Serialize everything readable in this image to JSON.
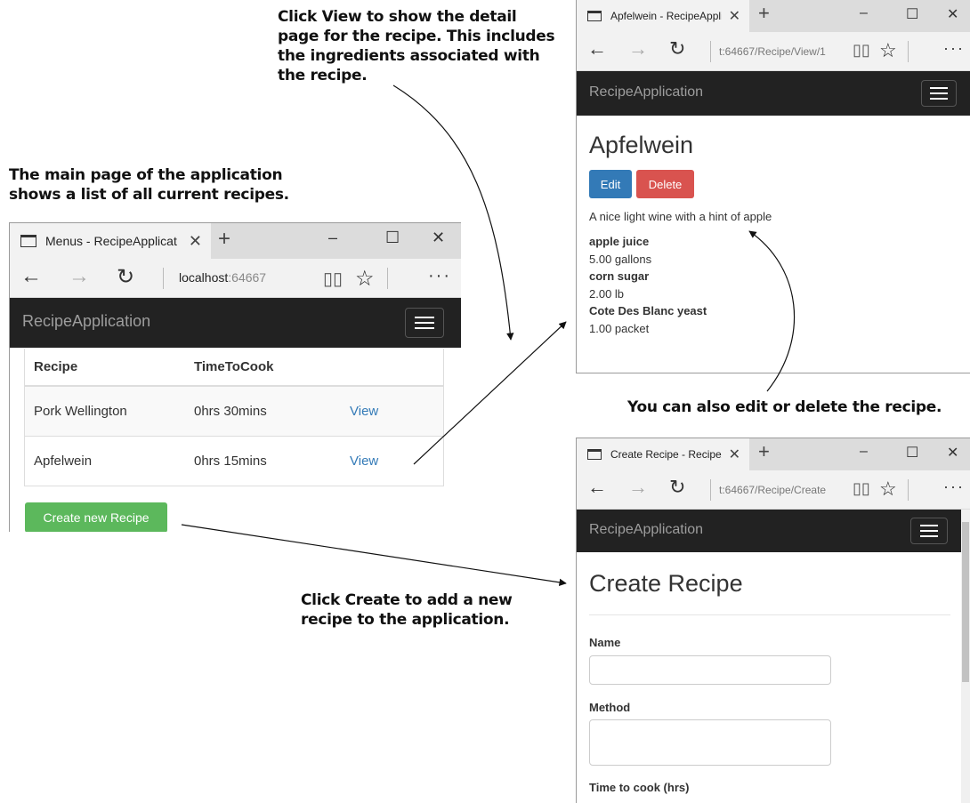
{
  "annotations": {
    "view": [
      "Click View to show the detail",
      "page for the recipe. This includes",
      "the ingredients associated with",
      "the recipe."
    ],
    "main": [
      "The main page of the application",
      "shows a list of all current recipes."
    ],
    "edit": "You can also edit or delete the recipe.",
    "create": [
      "Click Create to add a new",
      "recipe to the application."
    ]
  },
  "main_window": {
    "tab_title": "Menus - RecipeApplicat",
    "url_host": "localhost",
    "url_port": ":64667",
    "brand": "RecipeApplication",
    "table": {
      "headers": [
        "Recipe",
        "TimeToCook",
        ""
      ],
      "rows": [
        {
          "name": "Pork Wellington",
          "time": "0hrs 30mins",
          "action": "View"
        },
        {
          "name": "Apfelwein",
          "time": "0hrs 15mins",
          "action": "View"
        }
      ]
    },
    "create_button": "Create new Recipe"
  },
  "detail_window": {
    "tab_title": "Apfelwein - RecipeAppli",
    "url": "t:64667/Recipe/View/1",
    "brand": "RecipeApplication",
    "title": "Apfelwein",
    "edit_button": "Edit",
    "delete_button": "Delete",
    "description": "A nice light wine with a hint of apple",
    "ingredients": [
      {
        "name": "apple juice",
        "amount": "5.00 gallons"
      },
      {
        "name": "corn sugar",
        "amount": "2.00 lb"
      },
      {
        "name": "Cote Des Blanc yeast",
        "amount": "1.00 packet"
      }
    ]
  },
  "create_window": {
    "tab_title": "Create Recipe - RecipeA",
    "url": "t:64667/Recipe/Create",
    "brand": "RecipeApplication",
    "title": "Create Recipe",
    "fields": {
      "name_label": "Name",
      "method_label": "Method",
      "time_label": "Time to cook (hrs)"
    }
  },
  "icons": {
    "close": "✕",
    "new_tab": "+",
    "minimize": "–",
    "maximize": "☐",
    "back": "←",
    "forward": "→",
    "refresh": "↻",
    "reading_view": "📖",
    "favorite": "☆",
    "more": "···"
  },
  "colors": {
    "navbar": "#222222",
    "primary": "#337ab7",
    "danger": "#d9534f",
    "success": "#5cb85c"
  }
}
